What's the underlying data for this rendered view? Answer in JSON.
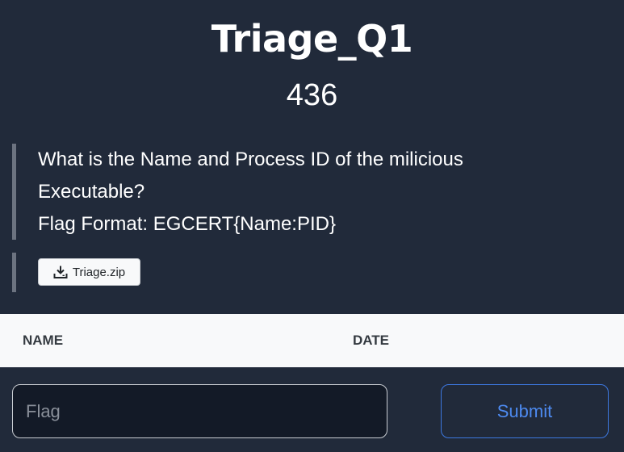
{
  "challenge": {
    "title": "Triage_Q1",
    "points": "436",
    "description_lines": [
      "What is the Name and Process ID of the milicious",
      "Executable?",
      "Flag Format: EGCERT{Name:PID}"
    ],
    "file_label": "Triage.zip",
    "file_icon": "download-icon"
  },
  "solves_table": {
    "columns": [
      "NAME",
      "DATE"
    ]
  },
  "submission": {
    "flag_placeholder": "Flag",
    "flag_value": "",
    "submit_label": "Submit",
    "accent_color": "#4d8af0"
  },
  "colors": {
    "background": "#212a3a",
    "quote_border": "#6c7380",
    "table_header_bg": "#f8f9fa"
  }
}
